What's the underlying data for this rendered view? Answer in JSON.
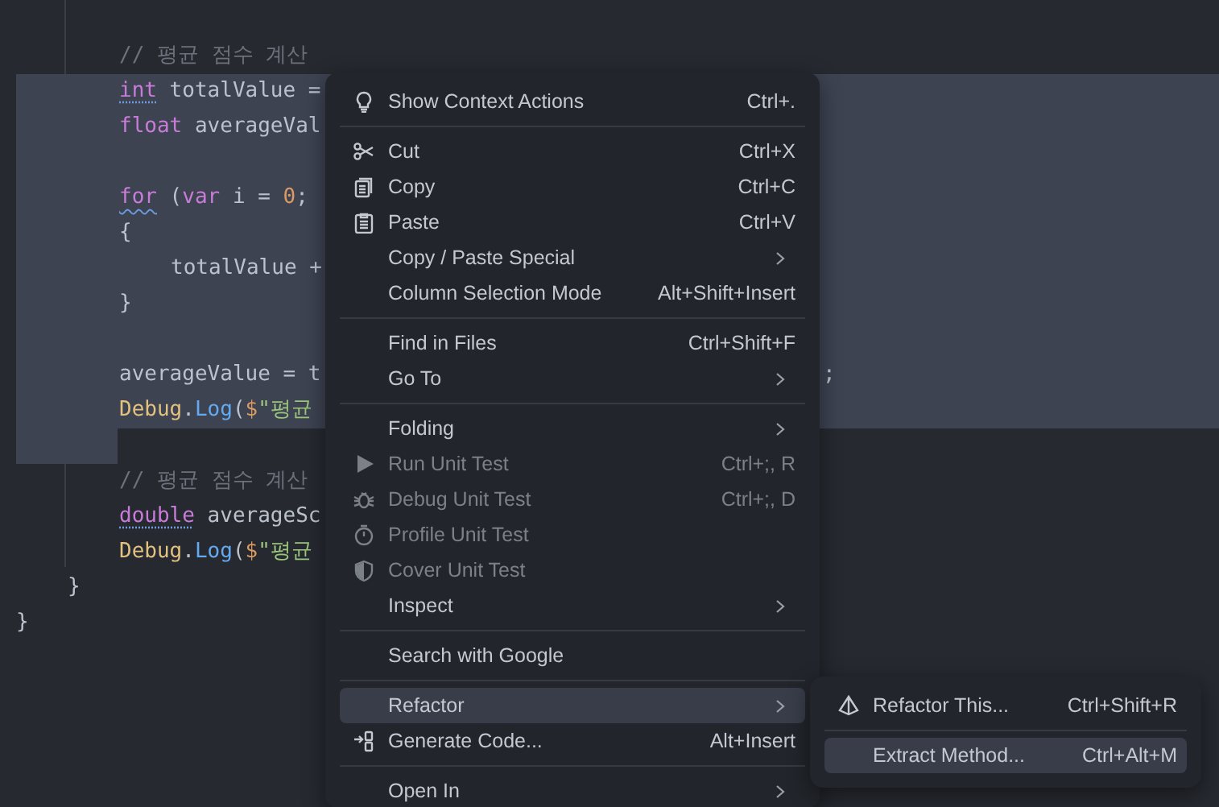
{
  "editor": {
    "lines": [
      {
        "kind": "code",
        "selected": false,
        "tokens": [
          {
            "kind": "comment",
            "text": "// 평균 점수 계산"
          }
        ]
      },
      {
        "kind": "code",
        "selected": true,
        "tokens": [
          {
            "kind": "keyword",
            "text": "int",
            "hint": true
          },
          {
            "kind": "plain",
            "text": " totalValue ="
          }
        ]
      },
      {
        "kind": "code",
        "selected": true,
        "tokens": [
          {
            "kind": "keyword",
            "text": "float"
          },
          {
            "kind": "plain",
            "text": " averageVal"
          }
        ]
      },
      {
        "kind": "blank",
        "selected": true
      },
      {
        "kind": "code",
        "selected": true,
        "tokens": [
          {
            "kind": "keyword",
            "text": "for",
            "warning": true
          },
          {
            "kind": "plain",
            "text": " ("
          },
          {
            "kind": "keyword",
            "text": "var"
          },
          {
            "kind": "plain",
            "text": " i = "
          },
          {
            "kind": "number",
            "text": "0"
          },
          {
            "kind": "plain",
            "text": ";"
          }
        ]
      },
      {
        "kind": "code",
        "selected": true,
        "tokens": [
          {
            "kind": "plain",
            "text": "{"
          }
        ]
      },
      {
        "kind": "nested",
        "selected": true,
        "tokens": [
          {
            "kind": "plain",
            "text": "totalValue +"
          }
        ]
      },
      {
        "kind": "code",
        "selected": true,
        "tokens": [
          {
            "kind": "plain",
            "text": "}"
          }
        ]
      },
      {
        "kind": "blank",
        "selected": true
      },
      {
        "kind": "code",
        "selected": true,
        "tokens": [
          {
            "kind": "plain",
            "text": "averageValue = t"
          }
        ],
        "tail": ";"
      },
      {
        "kind": "code",
        "selected": true,
        "tokens": [
          {
            "kind": "type",
            "text": "Debug"
          },
          {
            "kind": "plain",
            "text": "."
          },
          {
            "kind": "method",
            "text": "Log"
          },
          {
            "kind": "plain",
            "text": "("
          },
          {
            "kind": "number",
            "text": "$"
          },
          {
            "kind": "string",
            "text": "\"평균"
          }
        ]
      },
      {
        "kind": "selection-end",
        "selected": true
      },
      {
        "kind": "code",
        "selected": false,
        "tokens": [
          {
            "kind": "comment",
            "text": "// 평균 점수 계산"
          }
        ]
      },
      {
        "kind": "code",
        "selected": false,
        "tokens": [
          {
            "kind": "keyword",
            "text": "double",
            "hint": true
          },
          {
            "kind": "plain",
            "text": " averageSc"
          }
        ]
      },
      {
        "kind": "code",
        "selected": false,
        "tokens": [
          {
            "kind": "type",
            "text": "Debug"
          },
          {
            "kind": "plain",
            "text": "."
          },
          {
            "kind": "method",
            "text": "Log"
          },
          {
            "kind": "plain",
            "text": "("
          },
          {
            "kind": "number",
            "text": "$"
          },
          {
            "kind": "string",
            "text": "\"평균"
          }
        ]
      },
      {
        "kind": "outer",
        "selected": false,
        "tokens": [
          {
            "kind": "plain",
            "text": "}"
          }
        ]
      },
      {
        "kind": "root",
        "selected": false,
        "tokens": [
          {
            "kind": "plain",
            "text": "}"
          }
        ]
      }
    ]
  },
  "context_menu": {
    "items": [
      {
        "kind": "item",
        "label": "Show Context Actions",
        "shortcut": "Ctrl+.",
        "disabled": false,
        "selected": false,
        "submenu": false
      },
      {
        "kind": "separator"
      },
      {
        "kind": "item",
        "label": "Cut",
        "shortcut": "Ctrl+X",
        "disabled": false,
        "selected": false,
        "submenu": false
      },
      {
        "kind": "item",
        "label": "Copy",
        "shortcut": "Ctrl+C",
        "disabled": false,
        "selected": false,
        "submenu": false
      },
      {
        "kind": "item",
        "label": "Paste",
        "shortcut": "Ctrl+V",
        "disabled": false,
        "selected": false,
        "submenu": false
      },
      {
        "kind": "item",
        "label": "Copy / Paste Special",
        "disabled": false,
        "selected": false,
        "submenu": true
      },
      {
        "kind": "item",
        "label": "Column Selection Mode",
        "shortcut": "Alt+Shift+Insert",
        "disabled": false,
        "selected": false,
        "submenu": false
      },
      {
        "kind": "separator"
      },
      {
        "kind": "item",
        "label": "Find in Files",
        "shortcut": "Ctrl+Shift+F",
        "disabled": false,
        "selected": false,
        "submenu": false
      },
      {
        "kind": "item",
        "label": "Go To",
        "disabled": false,
        "selected": false,
        "submenu": true
      },
      {
        "kind": "separator"
      },
      {
        "kind": "item",
        "label": "Folding",
        "disabled": false,
        "selected": false,
        "submenu": true
      },
      {
        "kind": "item",
        "label": "Run Unit Test",
        "shortcut": "Ctrl+;, R",
        "disabled": true,
        "selected": false,
        "submenu": false
      },
      {
        "kind": "item",
        "label": "Debug Unit Test",
        "shortcut": "Ctrl+;, D",
        "disabled": true,
        "selected": false,
        "submenu": false
      },
      {
        "kind": "item",
        "label": "Profile Unit Test",
        "disabled": true,
        "selected": false,
        "submenu": false
      },
      {
        "kind": "item",
        "label": "Cover Unit Test",
        "disabled": true,
        "selected": false,
        "submenu": false
      },
      {
        "kind": "item",
        "label": "Inspect",
        "disabled": false,
        "selected": false,
        "submenu": true
      },
      {
        "kind": "separator"
      },
      {
        "kind": "item",
        "label": "Search with Google",
        "disabled": false,
        "selected": false,
        "submenu": false
      },
      {
        "kind": "separator"
      },
      {
        "kind": "item",
        "label": "Refactor",
        "disabled": false,
        "selected": true,
        "submenu": true
      },
      {
        "kind": "item",
        "label": "Generate Code...",
        "shortcut": "Alt+Insert",
        "disabled": false,
        "selected": false,
        "submenu": false
      },
      {
        "kind": "separator"
      },
      {
        "kind": "item",
        "label": "Open In",
        "disabled": false,
        "selected": false,
        "submenu": true
      }
    ]
  },
  "submenu": {
    "items": [
      {
        "kind": "item",
        "label": "Refactor This...",
        "shortcut": "Ctrl+Shift+R",
        "disabled": false,
        "selected": false,
        "submenu": false
      },
      {
        "kind": "separator"
      },
      {
        "kind": "item",
        "label": "Extract Method...",
        "shortcut": "Ctrl+Alt+M",
        "disabled": false,
        "selected": true,
        "submenu": false
      }
    ]
  }
}
